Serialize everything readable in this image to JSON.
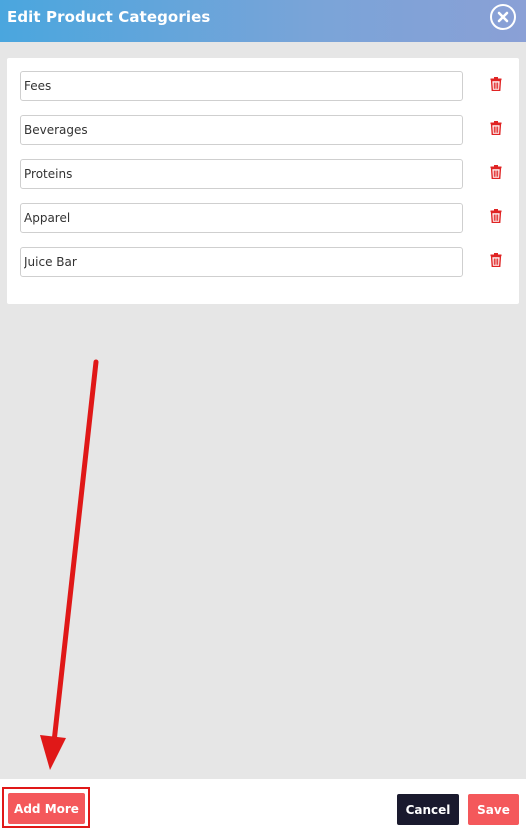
{
  "dialog": {
    "title": "Edit Product Categories",
    "close_icon": "close-circle-icon"
  },
  "categories": [
    {
      "value": "Fees"
    },
    {
      "value": "Beverages"
    },
    {
      "value": "Proteins"
    },
    {
      "value": "Apparel"
    },
    {
      "value": "Juice Bar"
    }
  ],
  "footer": {
    "add_more_label": "Add More",
    "cancel_label": "Cancel",
    "save_label": "Save"
  },
  "colors": {
    "header_gradient_start": "#4aa6de",
    "header_gradient_end": "#8aa0d6",
    "trash_icon": "#e02424",
    "primary_button": "#f4585b",
    "cancel_button": "#1a1a2e",
    "annotation": "#e01818"
  }
}
